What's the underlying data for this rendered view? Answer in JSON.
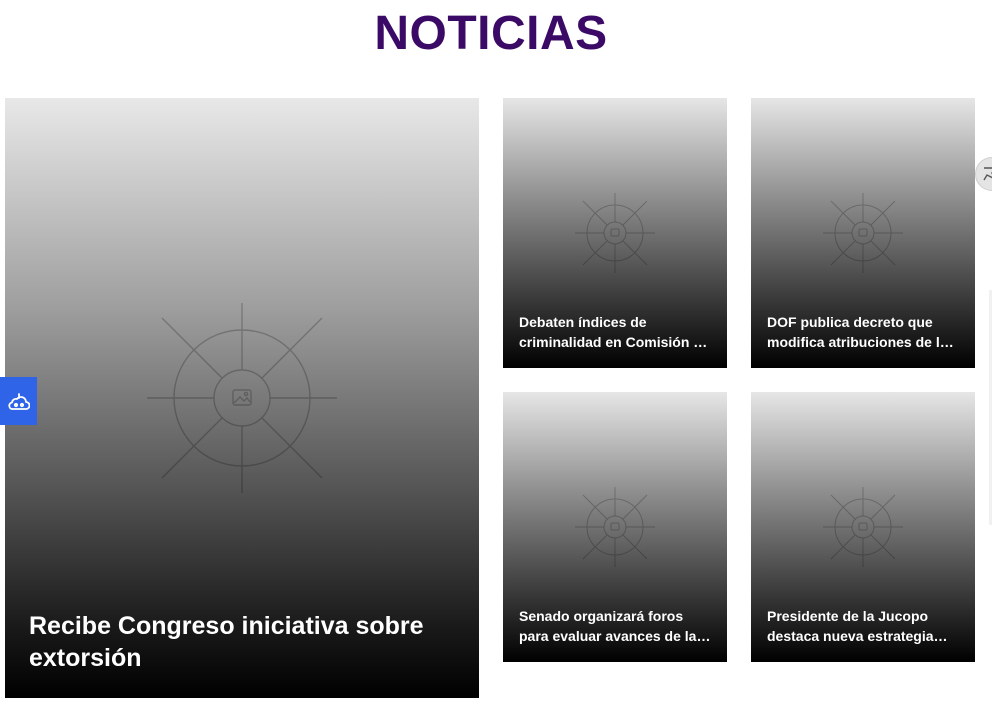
{
  "section": {
    "title": "NOTICIAS"
  },
  "featured": {
    "title": "Recibe Congreso iniciativa sobre extorsión",
    "image_icon": "image-placeholder-icon"
  },
  "news": [
    {
      "title": "Debaten índices de criminalidad en Comisión de Seguridad",
      "image_icon": "image-placeholder-icon"
    },
    {
      "title": "DOF publica decreto que modifica atribuciones de la Secretaría",
      "image_icon": "image-placeholder-icon"
    },
    {
      "title": "Senado organizará foros para evaluar avances de la reforma",
      "image_icon": "image-placeholder-icon"
    },
    {
      "title": "Presidente de la Jucopo destaca nueva estrategia legislativa",
      "image_icon": "image-placeholder-icon"
    }
  ],
  "widgets": {
    "side_icon": "accessibility-cloud-icon",
    "edge_icon": "pin-icon"
  },
  "colors": {
    "title": "#3b0a66",
    "widget": "#2f63e8",
    "card_text": "#ffffff"
  }
}
